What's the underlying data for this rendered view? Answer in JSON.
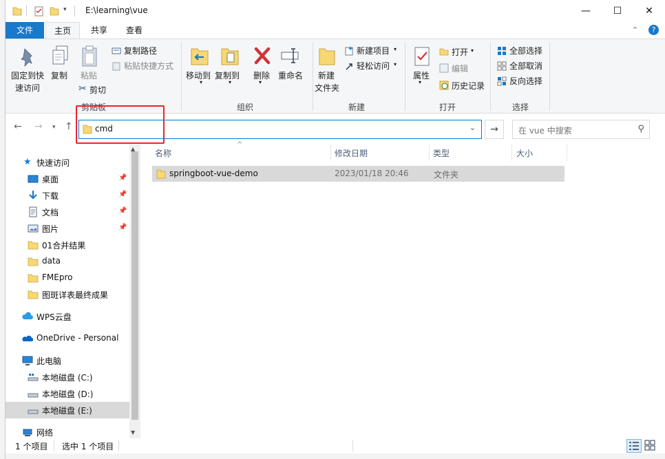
{
  "window": {
    "path": "E:\\learning\\vue",
    "controls": {
      "minimize": "—",
      "maximize": "☐",
      "close": "✕"
    }
  },
  "tabs": [
    {
      "label": "文件",
      "active": false
    },
    {
      "label": "主页",
      "active": true
    },
    {
      "label": "共享",
      "active": false
    },
    {
      "label": "查看",
      "active": false
    }
  ],
  "ribbon": {
    "clipboard": {
      "title": "剪贴板",
      "pin_label_1": "固定到快",
      "pin_label_2": "速访问",
      "copy": "复制",
      "paste": "粘贴",
      "copy_path": "复制路径",
      "paste_shortcut": "粘贴快捷方式",
      "cut": "剪切"
    },
    "organize": {
      "title": "组织",
      "move_to": "移动到",
      "copy_to": "复制到",
      "delete": "删除",
      "rename": "重命名"
    },
    "new": {
      "title": "新建",
      "new_folder_1": "新建",
      "new_folder_2": "文件夹",
      "new_item": "新建项目",
      "easy_access": "轻松访问"
    },
    "open": {
      "title": "打开",
      "properties": "属性",
      "open": "打开",
      "edit": "编辑",
      "history": "历史记录"
    },
    "select": {
      "title": "选择",
      "select_all": "全部选择",
      "select_none": "全部取消",
      "invert": "反向选择"
    }
  },
  "address": {
    "value": "cmd",
    "search_placeholder": "在 vue 中搜索"
  },
  "sidebar": {
    "quick_access": "快速访问",
    "items": [
      {
        "label": "桌面",
        "pinned": true,
        "icon": "desktop-icon"
      },
      {
        "label": "下载",
        "pinned": true,
        "icon": "download-icon"
      },
      {
        "label": "文档",
        "pinned": true,
        "icon": "document-icon"
      },
      {
        "label": "图片",
        "pinned": true,
        "icon": "picture-icon"
      },
      {
        "label": "01合并结果",
        "pinned": false,
        "icon": "folder-icon"
      },
      {
        "label": "data",
        "pinned": false,
        "icon": "folder-icon"
      },
      {
        "label": "FMEpro",
        "pinned": false,
        "icon": "folder-icon"
      },
      {
        "label": "图斑详表最终成果",
        "pinned": false,
        "icon": "folder-icon"
      }
    ],
    "wps": "WPS云盘",
    "onedrive": "OneDrive - Personal",
    "this_pc": "此电脑",
    "drives": [
      {
        "label": "本地磁盘 (C:)"
      },
      {
        "label": "本地磁盘 (D:)"
      },
      {
        "label": "本地磁盘 (E:)",
        "selected": true
      }
    ],
    "network": "网络"
  },
  "columns": {
    "name": "名称",
    "modified": "修改日期",
    "type": "类型",
    "size": "大小"
  },
  "files": [
    {
      "name": "springboot-vue-demo",
      "modified": "2023/01/18 20:46",
      "type": "文件夹",
      "size": ""
    }
  ],
  "status": {
    "count": "1 个项目",
    "selected": "选中 1 个项目"
  },
  "colors": {
    "accent": "#1979ca",
    "highlight_box": "#e8262a",
    "folder": "#f8d775"
  }
}
